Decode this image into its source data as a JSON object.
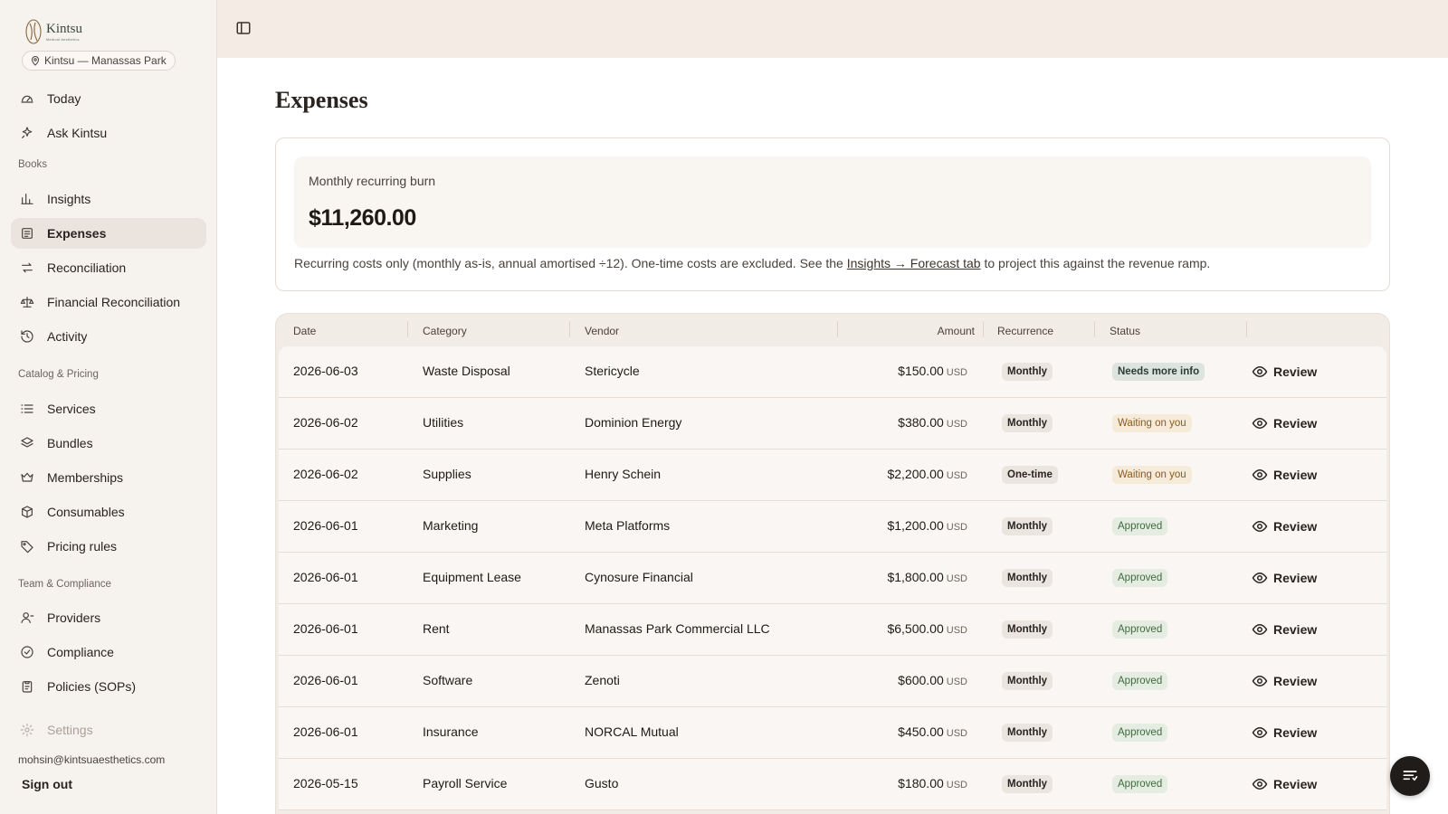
{
  "brand": {
    "name": "Kintsu",
    "subtitle": "Medical Aesthetics",
    "location": "Kintsu — Manassas Park"
  },
  "sidebar": {
    "top_items": [
      {
        "label": "Today",
        "icon": "gauge-icon"
      },
      {
        "label": "Ask Kintsu",
        "icon": "sparkle-icon"
      }
    ],
    "sections": [
      {
        "title": "Books",
        "items": [
          {
            "label": "Insights",
            "icon": "bar-chart-icon"
          },
          {
            "label": "Expenses",
            "icon": "receipt-icon",
            "active": true
          },
          {
            "label": "Reconciliation",
            "icon": "arrows-swap-icon"
          },
          {
            "label": "Financial Reconciliation",
            "icon": "scale-icon"
          },
          {
            "label": "Activity",
            "icon": "history-icon"
          }
        ]
      },
      {
        "title": "Catalog & Pricing",
        "items": [
          {
            "label": "Services",
            "icon": "list-icon"
          },
          {
            "label": "Bundles",
            "icon": "layers-icon"
          },
          {
            "label": "Memberships",
            "icon": "crown-icon"
          },
          {
            "label": "Consumables",
            "icon": "package-icon"
          },
          {
            "label": "Pricing rules",
            "icon": "tag-icon"
          }
        ]
      },
      {
        "title": "Team & Compliance",
        "items": [
          {
            "label": "Providers",
            "icon": "user-icon"
          },
          {
            "label": "Compliance",
            "icon": "check-badge-icon"
          },
          {
            "label": "Policies (SOPs)",
            "icon": "clipboard-icon"
          }
        ]
      }
    ],
    "settings": {
      "label": "Settings",
      "icon": "gear-icon"
    },
    "user_email": "mohsin@kintsuaesthetics.com",
    "sign_out": "Sign out"
  },
  "page": {
    "title": "Expenses"
  },
  "summary": {
    "label": "Monthly recurring burn",
    "value": "$11,260.00",
    "note_before": "Recurring costs only (monthly as-is, annual amortised ÷12). One-time costs are excluded. See the ",
    "note_link": "Insights → Forecast tab",
    "note_after": " to project this against the revenue ramp."
  },
  "table": {
    "columns": [
      "Date",
      "Category",
      "Vendor",
      "Amount",
      "Recurrence",
      "Status"
    ],
    "action_label": "Review",
    "rows": [
      {
        "date": "2026-06-03",
        "category": "Waste Disposal",
        "vendor": "Stericycle",
        "amount": "$150.00",
        "currency": "USD",
        "recurrence": "Monthly",
        "status": "Needs more info",
        "status_kind": "info"
      },
      {
        "date": "2026-06-02",
        "category": "Utilities",
        "vendor": "Dominion Energy",
        "amount": "$380.00",
        "currency": "USD",
        "recurrence": "Monthly",
        "status": "Waiting on you",
        "status_kind": "wait"
      },
      {
        "date": "2026-06-02",
        "category": "Supplies",
        "vendor": "Henry Schein",
        "amount": "$2,200.00",
        "currency": "USD",
        "recurrence": "One-time",
        "status": "Waiting on you",
        "status_kind": "wait"
      },
      {
        "date": "2026-06-01",
        "category": "Marketing",
        "vendor": "Meta Platforms",
        "amount": "$1,200.00",
        "currency": "USD",
        "recurrence": "Monthly",
        "status": "Approved",
        "status_kind": "ok"
      },
      {
        "date": "2026-06-01",
        "category": "Equipment Lease",
        "vendor": "Cynosure Financial",
        "amount": "$1,800.00",
        "currency": "USD",
        "recurrence": "Monthly",
        "status": "Approved",
        "status_kind": "ok"
      },
      {
        "date": "2026-06-01",
        "category": "Rent",
        "vendor": "Manassas Park Commercial LLC",
        "amount": "$6,500.00",
        "currency": "USD",
        "recurrence": "Monthly",
        "status": "Approved",
        "status_kind": "ok"
      },
      {
        "date": "2026-06-01",
        "category": "Software",
        "vendor": "Zenoti",
        "amount": "$600.00",
        "currency": "USD",
        "recurrence": "Monthly",
        "status": "Approved",
        "status_kind": "ok"
      },
      {
        "date": "2026-06-01",
        "category": "Insurance",
        "vendor": "NORCAL Mutual",
        "amount": "$450.00",
        "currency": "USD",
        "recurrence": "Monthly",
        "status": "Approved",
        "status_kind": "ok"
      },
      {
        "date": "2026-05-15",
        "category": "Payroll Service",
        "vendor": "Gusto",
        "amount": "$180.00",
        "currency": "USD",
        "recurrence": "Monthly",
        "status": "Approved",
        "status_kind": "ok"
      }
    ]
  },
  "fab": {
    "icon": "filter-list-icon"
  }
}
